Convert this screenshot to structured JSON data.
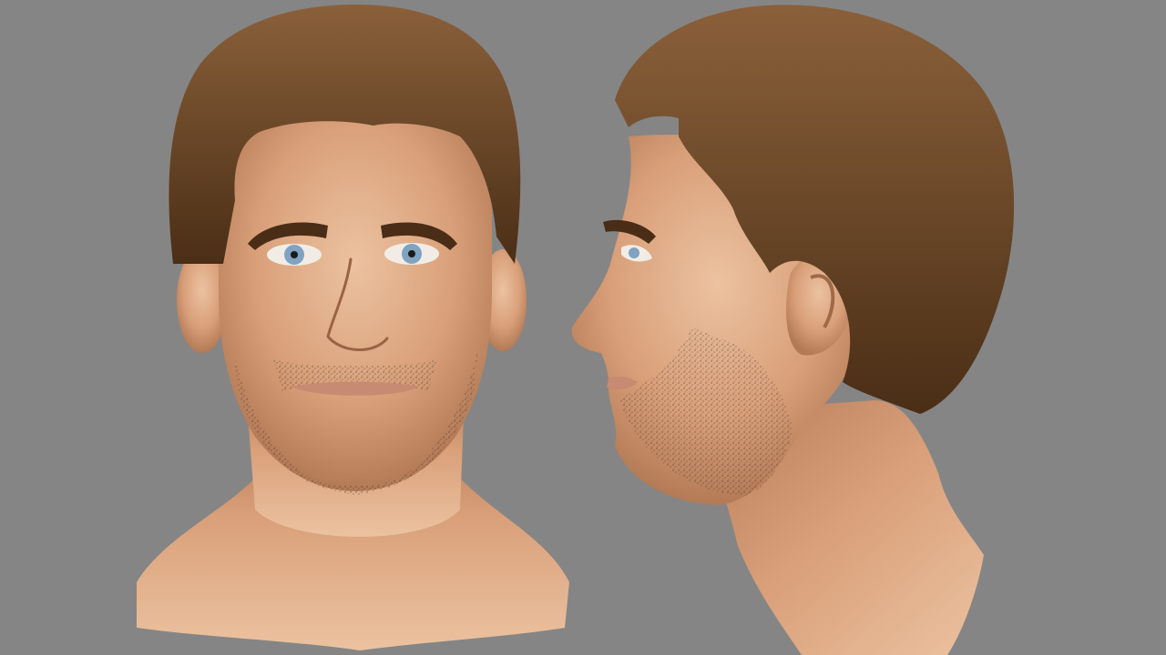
{
  "scene": {
    "background_color": "#858585",
    "views": [
      {
        "view": "front",
        "description_hidden": true
      },
      {
        "view": "side-profile-left-facing",
        "description_hidden": true
      }
    ]
  },
  "palette": {
    "skin": "#d9a07a",
    "skin_shadow": "#b37a56",
    "skin_highlight": "#ecc2a0",
    "hair": "#6b4526",
    "hair_dark": "#4a2e16",
    "hair_light": "#8a603a",
    "brow": "#4a2d17",
    "iris": "#7fa3c0",
    "stubble": "#3a2a22",
    "lips": "#c78a72"
  }
}
